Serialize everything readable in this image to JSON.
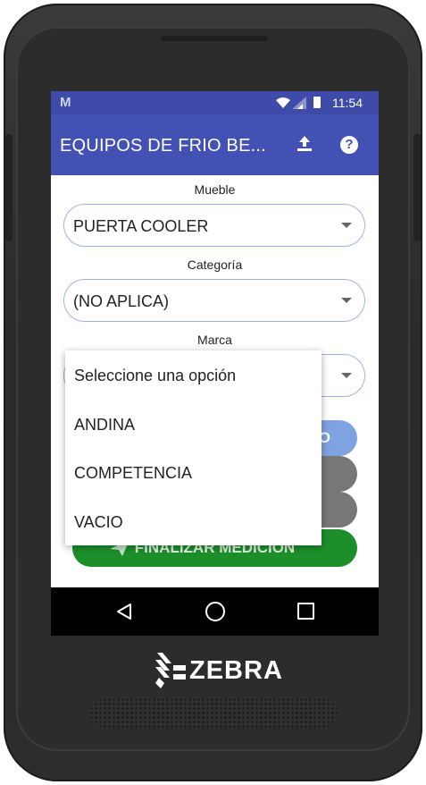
{
  "device": {
    "brand": "ZEBRA"
  },
  "status_bar": {
    "notification_icon": "M",
    "time": "11:54"
  },
  "app_bar": {
    "title": "EQUIPOS DE FRIO BE...",
    "upload_icon": "upload-icon",
    "help_icon": "help-icon",
    "help_glyph": "?"
  },
  "form": {
    "mueble": {
      "label": "Mueble",
      "value": "PUERTA COOLER"
    },
    "categoria": {
      "label": "Categoría",
      "value": "(NO APLICA)"
    },
    "marca": {
      "label": "Marca",
      "value": ""
    }
  },
  "dropdown": {
    "options": [
      "Seleccione una opción",
      "ANDINA",
      "COMPETENCIA",
      "VACIO"
    ]
  },
  "buttons": {
    "blue_partial": "O",
    "finalize": "FINALIZAR MEDICION"
  },
  "colors": {
    "app_bar": "#4351b5",
    "status_bar": "#3f4ba8",
    "select_border": "#9db5dc",
    "finalize_button": "#1c8f2a",
    "gray_button": "#777777",
    "blue_button": "#7ea3e0"
  }
}
